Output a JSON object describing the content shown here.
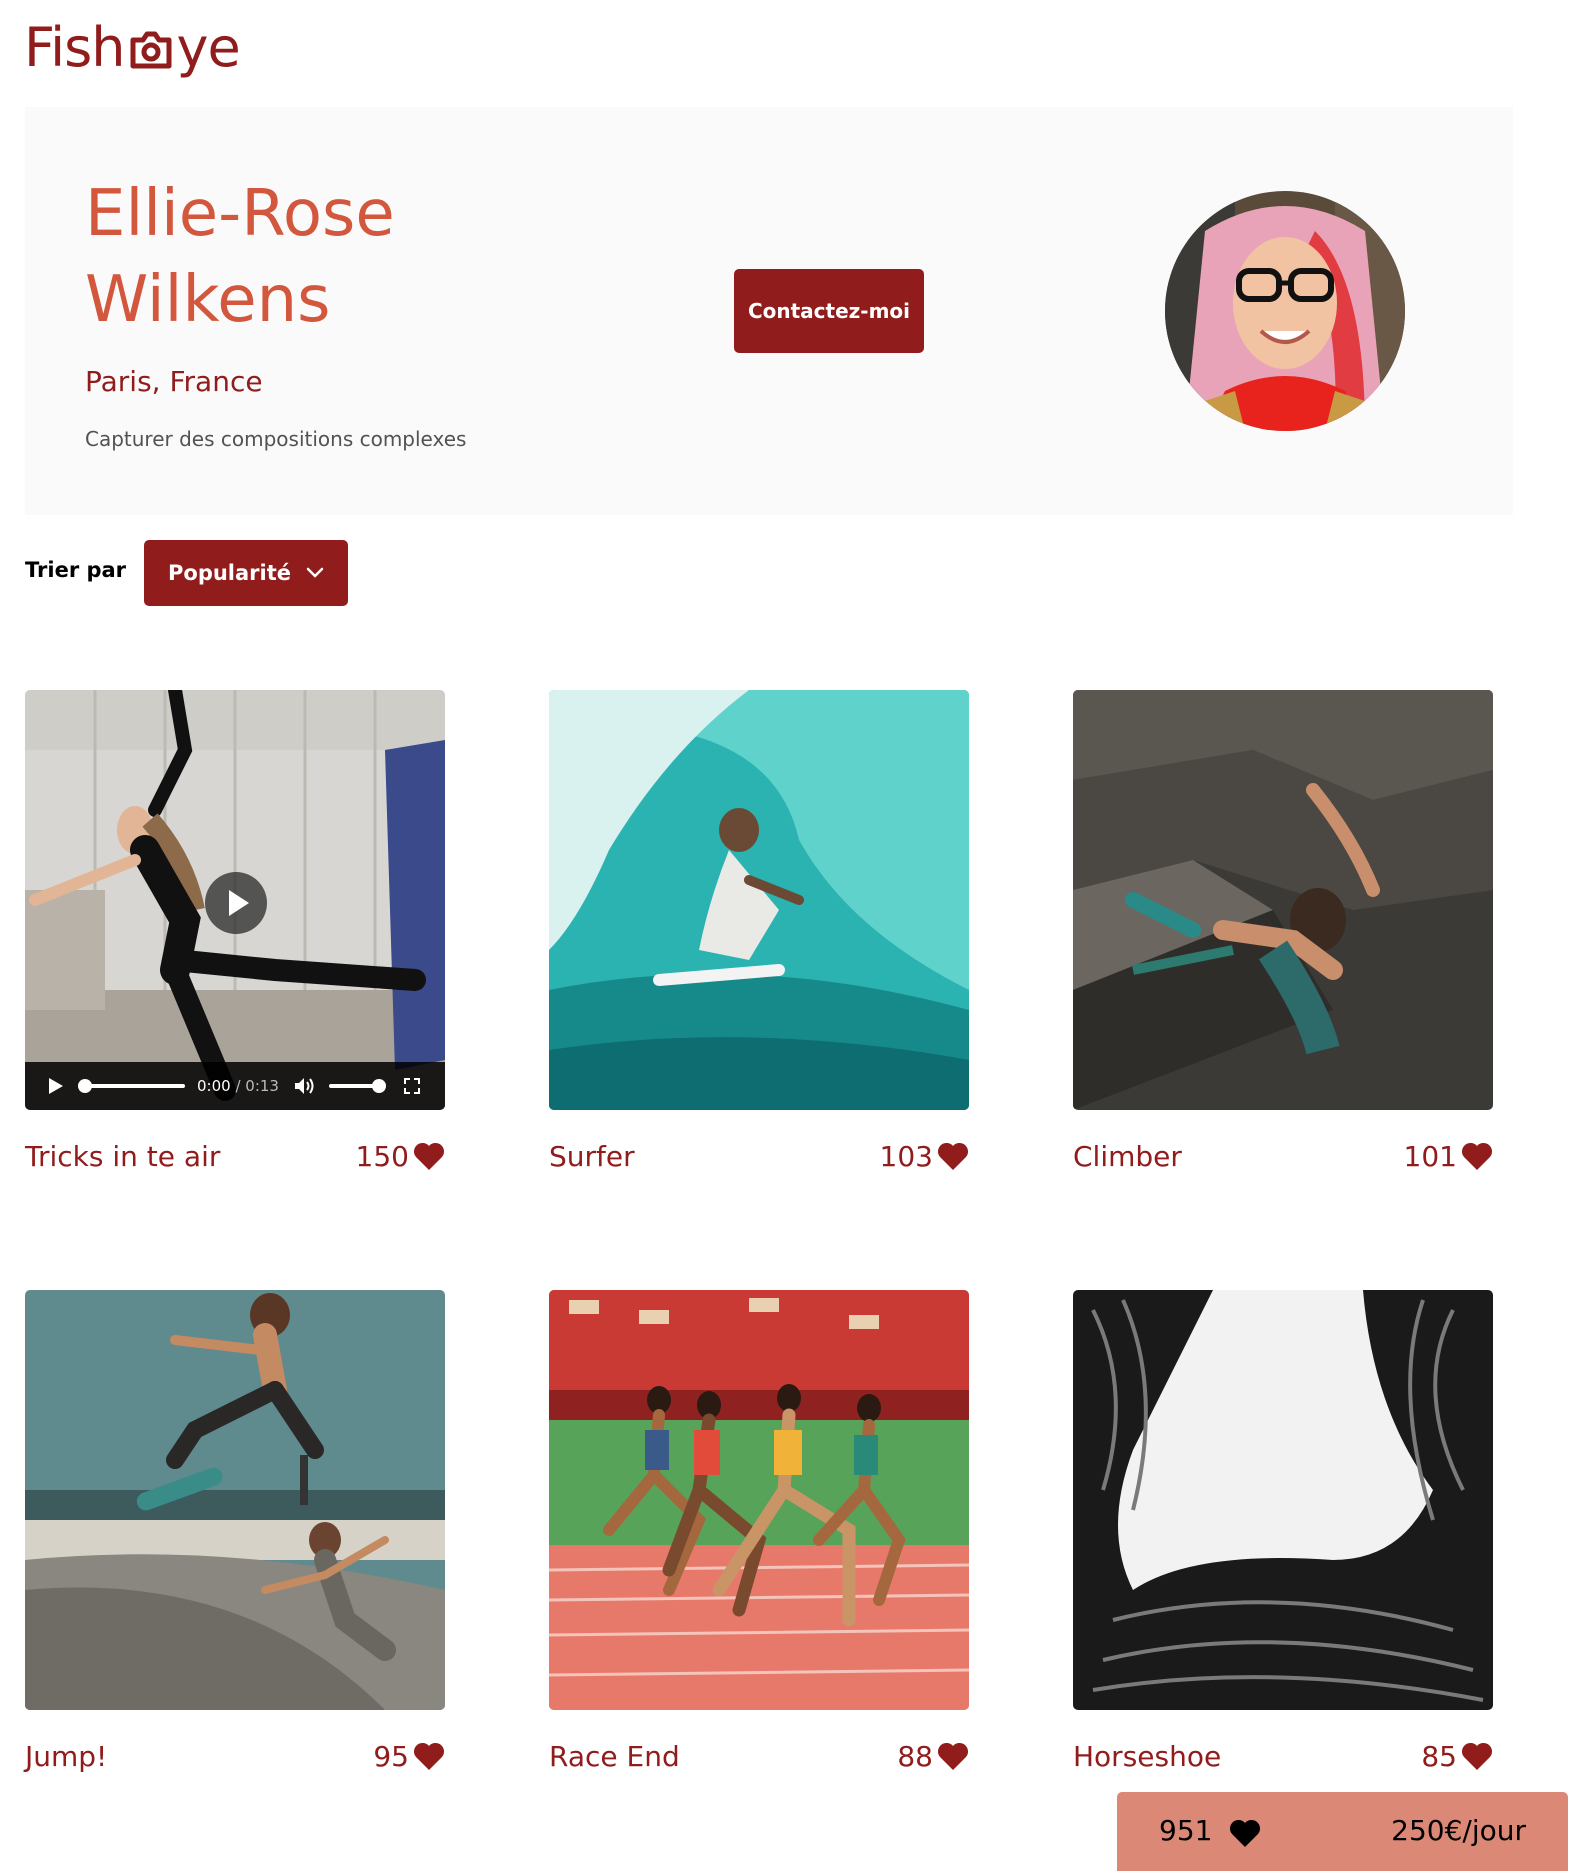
{
  "brand": {
    "name_left": "Fish",
    "name_right": "ye"
  },
  "photographer": {
    "name": "Ellie-Rose Wilkens",
    "location": "Paris, France",
    "tagline": "Capturer des compositions complexes",
    "contact_label": "Contactez-moi"
  },
  "sort": {
    "label": "Trier par",
    "selected": "Popularité"
  },
  "video": {
    "current_time": "0:00",
    "separator": " / ",
    "duration": "0:13"
  },
  "media": [
    {
      "title": "Tricks in te air",
      "likes": "150",
      "type": "video"
    },
    {
      "title": "Surfer",
      "likes": "103",
      "type": "image"
    },
    {
      "title": "Climber",
      "likes": "101",
      "type": "image"
    },
    {
      "title": "Jump!",
      "likes": "95",
      "type": "image"
    },
    {
      "title": "Race End",
      "likes": "88",
      "type": "image"
    },
    {
      "title": "Horseshoe",
      "likes": "85",
      "type": "image"
    }
  ],
  "stats": {
    "total_likes": "951",
    "price": "250€/jour"
  },
  "colors": {
    "primary": "#901c1c",
    "secondary": "#d3573c",
    "accent": "#db8876",
    "banner_bg": "#fafafa"
  }
}
